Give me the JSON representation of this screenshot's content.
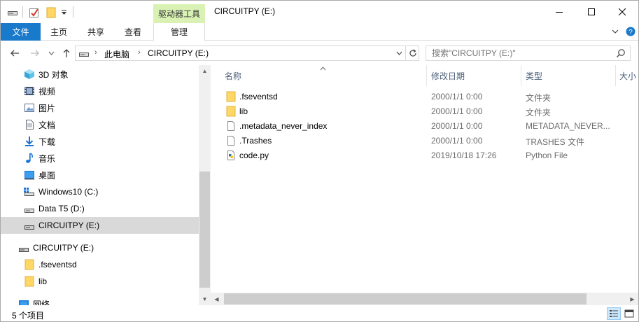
{
  "window": {
    "title": "CIRCUITPY (E:)",
    "context_group": "驱动器工具"
  },
  "ribbon": {
    "tabs": [
      {
        "label": "文件"
      },
      {
        "label": "主页"
      },
      {
        "label": "共享"
      },
      {
        "label": "查看"
      },
      {
        "label": "管理"
      }
    ]
  },
  "address": {
    "crumbs": [
      "此电脑",
      "CIRCUITPY (E:)"
    ]
  },
  "search": {
    "placeholder": "搜索\"CIRCUITPY (E:)\""
  },
  "nav": {
    "items": [
      {
        "label": "3D 对象",
        "icon": "3d-objects-icon"
      },
      {
        "label": "视频",
        "icon": "video-icon"
      },
      {
        "label": "图片",
        "icon": "pictures-icon"
      },
      {
        "label": "文档",
        "icon": "documents-icon"
      },
      {
        "label": "下载",
        "icon": "download-icon"
      },
      {
        "label": "音乐",
        "icon": "music-icon"
      },
      {
        "label": "桌面",
        "icon": "desktop-icon"
      },
      {
        "label": "Windows10 (C:)",
        "icon": "windows-drive-icon"
      },
      {
        "label": "Data T5 (D:)",
        "icon": "drive-icon"
      },
      {
        "label": "CIRCUITPY (E:)",
        "icon": "usb-drive-icon",
        "selected": true
      },
      {
        "label": "CIRCUITPY (E:)",
        "icon": "usb-drive-icon"
      },
      {
        "label": ".fseventsd",
        "icon": "folder-icon"
      },
      {
        "label": "lib",
        "icon": "folder-icon"
      },
      {
        "label": "网络",
        "icon": "network-icon"
      }
    ]
  },
  "columns": {
    "name": "名称",
    "modified": "修改日期",
    "type": "类型",
    "size": "大小"
  },
  "files": [
    {
      "name": ".fseventsd",
      "modified": "2000/1/1 0:00",
      "type": "文件夹",
      "icon": "folder-icon"
    },
    {
      "name": "lib",
      "modified": "2000/1/1 0:00",
      "type": "文件夹",
      "icon": "folder-icon"
    },
    {
      "name": ".metadata_never_index",
      "modified": "2000/1/1 0:00",
      "type": "METADATA_NEVER...",
      "icon": "file-icon"
    },
    {
      "name": ".Trashes",
      "modified": "2000/1/1 0:00",
      "type": "TRASHES 文件",
      "icon": "file-icon"
    },
    {
      "name": "code.py",
      "modified": "2019/10/18 17:26",
      "type": "Python File",
      "icon": "python-file-icon"
    }
  ],
  "status": {
    "count": "5 个项目"
  },
  "colors": {
    "file_tab": "#1979ca",
    "context_group": "#d9f2b4",
    "selection": "#d9d9d9",
    "folder": "#ffd767"
  }
}
